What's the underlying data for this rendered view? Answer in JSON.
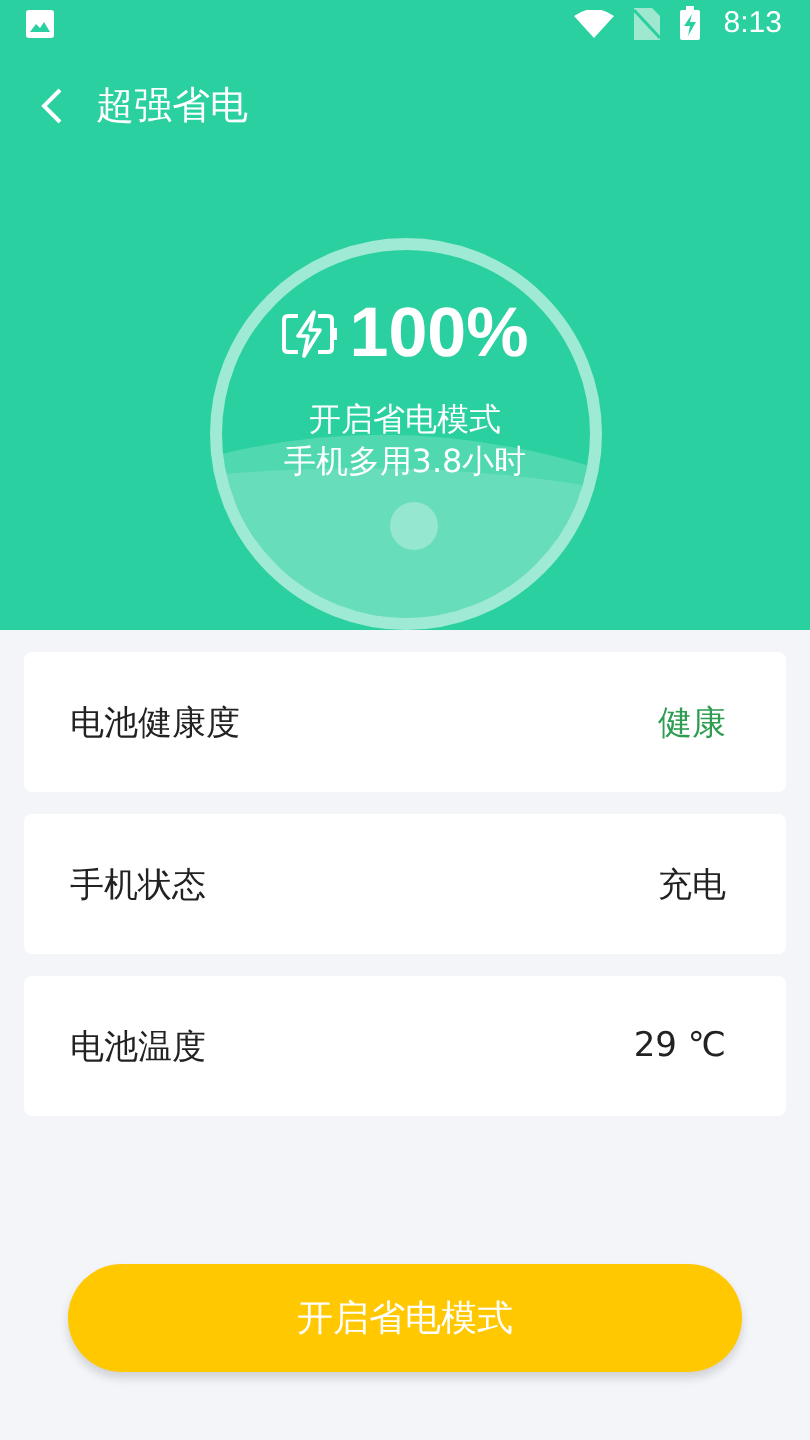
{
  "status_bar": {
    "time": "8:13"
  },
  "header": {
    "title": "超强省电"
  },
  "gauge": {
    "percent": "100%",
    "line1": "开启省电模式",
    "line2": "手机多用3.8小时"
  },
  "rows": [
    {
      "label": "电池健康度",
      "value": "健康",
      "color": "#2e9d52"
    },
    {
      "label": "手机状态",
      "value": "充电",
      "color": "#222222"
    },
    {
      "label": "电池温度",
      "value": "29 ℃",
      "color": "#222222"
    }
  ],
  "button": {
    "label": "开启省电模式"
  }
}
